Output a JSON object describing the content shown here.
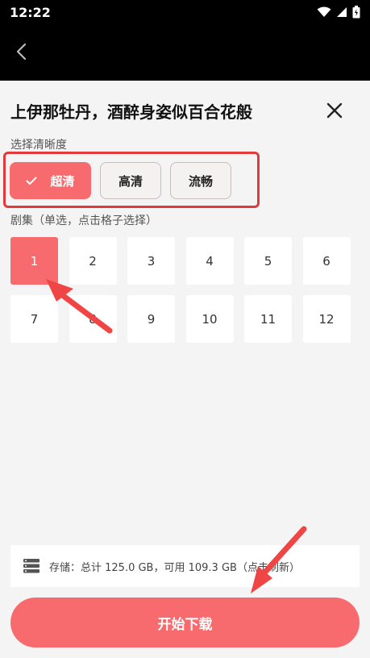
{
  "status": {
    "time": "12:22"
  },
  "sheet": {
    "title": "上伊那牡丹，酒醉身姿似百合花般",
    "quality_label": "选择清晰度",
    "qualities": [
      {
        "label": "超清",
        "selected": true
      },
      {
        "label": "高清",
        "selected": false
      },
      {
        "label": "流畅",
        "selected": false
      }
    ],
    "episode_label": "剧集（单选，点击格子选择）",
    "episodes": [
      "1",
      "2",
      "3",
      "4",
      "5",
      "6",
      "7",
      "8",
      "9",
      "10",
      "11",
      "12"
    ],
    "selected_episode": "1",
    "storage_text": "存储：总计 125.0 GB，可用 109.3 GB（点击刷新）",
    "download_label": "开始下载"
  },
  "colors": {
    "accent": "#f76a6d",
    "highlight": "#e23a3a"
  },
  "icons": [
    "wifi-icon",
    "signal-icon",
    "battery-icon",
    "back-arrow-icon",
    "close-icon",
    "check-icon",
    "storage-icon"
  ]
}
